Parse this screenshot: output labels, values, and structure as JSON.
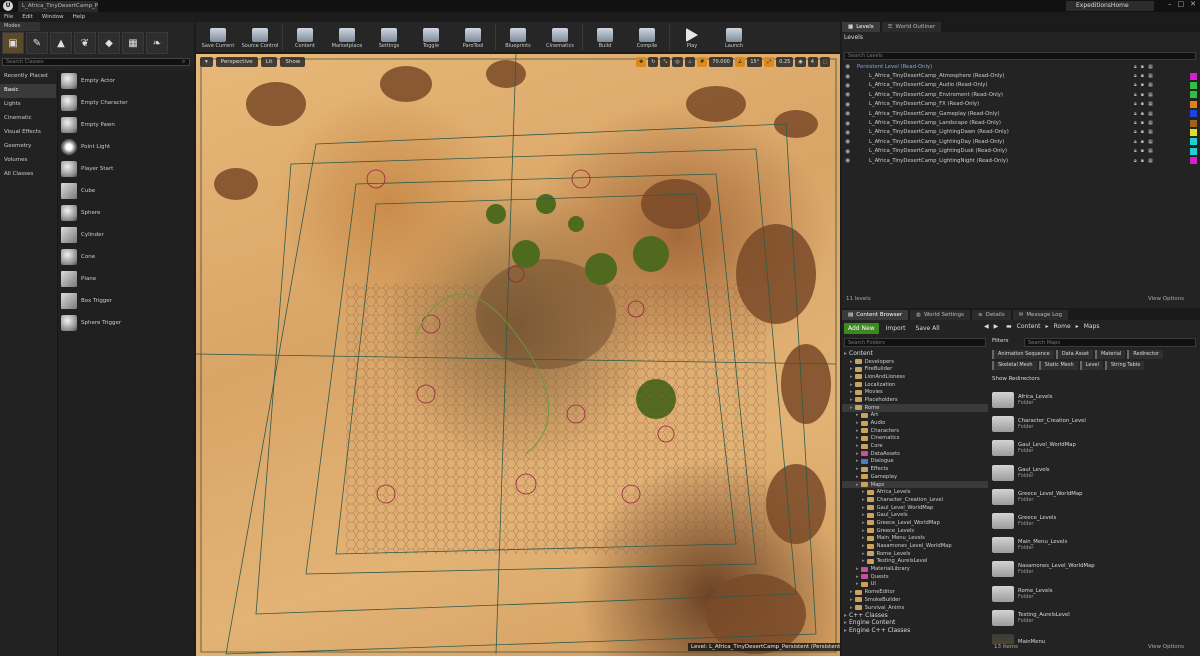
{
  "titlebar": {
    "tab": "L_Africa_TinyDesertCamp_Pi",
    "project": "ExpeditionsHome",
    "controls": [
      "–",
      "□",
      "✕"
    ]
  },
  "menu": [
    "File",
    "Edit",
    "Window",
    "Help"
  ],
  "modes": {
    "tab": "Modes",
    "search_placeholder": "Search Classes",
    "categories": [
      "Recently Placed",
      "Basic",
      "Lights",
      "Cinematic",
      "Visual Effects",
      "Geometry",
      "Volumes",
      "All Classes"
    ],
    "active_category": "Basic",
    "items": [
      "Empty Actor",
      "Empty Character",
      "Empty Pawn",
      "Point Light",
      "Player Start",
      "Cube",
      "Sphere",
      "Cylinder",
      "Cone",
      "Plane",
      "Box Trigger",
      "Sphere Trigger"
    ]
  },
  "toolbar": [
    "Save Current",
    "Source Control",
    "Content",
    "Marketplace",
    "Settings",
    "Toggle",
    "ParoTool",
    "Blueprints",
    "Cinematics",
    "Build",
    "Compile",
    "Play",
    "Launch"
  ],
  "viewport": {
    "perspective": "Perspective",
    "lit": "Lit",
    "show": "Show",
    "snap_value": "70.000",
    "angle_snap": "15°",
    "scale_snap": "0.25",
    "cam_speed": "4",
    "level_label": "Level: L_Africa_TinyDesertCamp_Persistent (Persistent)"
  },
  "levels": {
    "tabs": [
      "Levels",
      "World Outliner"
    ],
    "header": "Levels",
    "search_placeholder": "Search Levels",
    "rows": [
      {
        "name": "Persistent Level (Read-Only)",
        "persistent": true,
        "color": ""
      },
      {
        "name": "L_Africa_TinyDesertCamp_Atmosphere (Read-Only)",
        "color": "#d020d0"
      },
      {
        "name": "L_Africa_TinyDesertCamp_Audio (Read-Only)",
        "color": "#30c040"
      },
      {
        "name": "L_Africa_TinyDesertCamp_Enviroment (Read-Only)",
        "color": "#30c040"
      },
      {
        "name": "L_Africa_TinyDesertCamp_FX (Read-Only)",
        "color": "#e08020"
      },
      {
        "name": "L_Africa_TinyDesertCamp_Gameplay (Read-Only)",
        "color": "#2040e0"
      },
      {
        "name": "L_Africa_TinyDesertCamp_Landscape (Read-Only)",
        "color": "#a06020"
      },
      {
        "name": "L_Africa_TinyDesertCamp_LightingDawn (Read-Only)",
        "color": "#e0e020"
      },
      {
        "name": "L_Africa_TinyDesertCamp_LightingDay (Read-Only)",
        "color": "#20d0d0"
      },
      {
        "name": "L_Africa_TinyDesertCamp_LightingDusk (Read-Only)",
        "color": "#20d0d0"
      },
      {
        "name": "L_Africa_TinyDesertCamp_LightingNight (Read-Only)",
        "color": "#d020d0"
      }
    ],
    "count": "11 levels",
    "view_options": "View Options"
  },
  "content_browser": {
    "tabs": [
      "Content Browser",
      "World Settings",
      "Details",
      "Message Log"
    ],
    "add_new": "Add New",
    "import": "Import",
    "save_all": "Save All",
    "breadcrumb": [
      "Content",
      "Rome",
      "Maps"
    ],
    "folder_search_placeholder": "Search Folders",
    "filters": "Filters",
    "maps_search_placeholder": "Search Maps",
    "filter_chips": [
      "Animation Sequence",
      "Data Asset",
      "Material",
      "Redirector",
      "Skeletal Mesh",
      "Static Mesh",
      "Level",
      "String Table"
    ],
    "show_redirectors": "Show Redirectors",
    "tree": [
      {
        "label": "Content",
        "depth": 0,
        "hdr": true
      },
      {
        "label": "Developers",
        "depth": 1
      },
      {
        "label": "FireBuilder",
        "depth": 1
      },
      {
        "label": "LionAndLioness",
        "depth": 1
      },
      {
        "label": "Localization",
        "depth": 1
      },
      {
        "label": "Movies",
        "depth": 1
      },
      {
        "label": "Placeholders",
        "depth": 1
      },
      {
        "label": "Rome",
        "depth": 1,
        "sel": true
      },
      {
        "label": "Art",
        "depth": 2
      },
      {
        "label": "Audio",
        "depth": 2
      },
      {
        "label": "Characters",
        "depth": 2
      },
      {
        "label": "Cinematics",
        "depth": 2
      },
      {
        "label": "Core",
        "depth": 2
      },
      {
        "label": "DataAssets",
        "depth": 2,
        "color": "pink"
      },
      {
        "label": "Dialogue",
        "depth": 2,
        "color": "blue"
      },
      {
        "label": "Effects",
        "depth": 2
      },
      {
        "label": "Gameplay",
        "depth": 2
      },
      {
        "label": "Maps",
        "depth": 2,
        "sel": true
      },
      {
        "label": "Africa_Levels",
        "depth": 3
      },
      {
        "label": "Character_Creation_Level",
        "depth": 3
      },
      {
        "label": "Gaul_Level_WorldMap",
        "depth": 3
      },
      {
        "label": "Gaul_Levels",
        "depth": 3
      },
      {
        "label": "Greece_Level_WorldMap",
        "depth": 3
      },
      {
        "label": "Greece_Levels",
        "depth": 3
      },
      {
        "label": "Main_Menu_Levels",
        "depth": 3
      },
      {
        "label": "Nasamones_Level_WorldMap",
        "depth": 3
      },
      {
        "label": "Rome_Levels",
        "depth": 3
      },
      {
        "label": "Testing_AurelsLevel",
        "depth": 3
      },
      {
        "label": "MaterialLibrary",
        "depth": 2,
        "color": "pink"
      },
      {
        "label": "Quests",
        "depth": 2,
        "color": "pink"
      },
      {
        "label": "UI",
        "depth": 2
      },
      {
        "label": "RomeEditor",
        "depth": 1
      },
      {
        "label": "SmokeBuilder",
        "depth": 1
      },
      {
        "label": "Survival_Anims",
        "depth": 1
      },
      {
        "label": "C++ Classes",
        "depth": 0,
        "hdr": true
      },
      {
        "label": "Engine Content",
        "depth": 0,
        "hdr": true
      },
      {
        "label": "Engine C++ Classes",
        "depth": 0,
        "hdr": true
      }
    ],
    "assets": [
      {
        "name": "Africa_Levels",
        "type": "Folder"
      },
      {
        "name": "Character_Creation_Level",
        "type": "Folder"
      },
      {
        "name": "Gaul_Level_WorldMap",
        "type": "Folder"
      },
      {
        "name": "Gaul_Levels",
        "type": "Folder"
      },
      {
        "name": "Greece_Level_WorldMap",
        "type": "Folder"
      },
      {
        "name": "Greece_Levels",
        "type": "Folder"
      },
      {
        "name": "Main_Menu_Levels",
        "type": "Folder"
      },
      {
        "name": "Nasamones_Level_WorldMap",
        "type": "Folder"
      },
      {
        "name": "Rome_Levels",
        "type": "Folder"
      },
      {
        "name": "Testing_AurelsLevel",
        "type": "Folder"
      },
      {
        "name": "MainMenu",
        "type": "",
        "map": true
      }
    ],
    "count": "13 items",
    "view_options": "View Options"
  }
}
